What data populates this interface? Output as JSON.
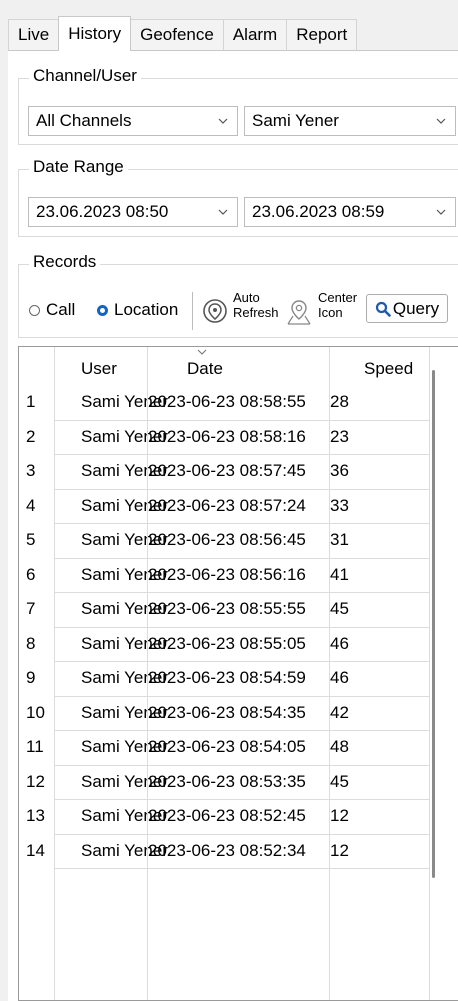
{
  "tabs": [
    "Live",
    "History",
    "Geofence",
    "Alarm",
    "Report"
  ],
  "active_tab": "History",
  "channel_user": {
    "title": "Channel/User",
    "channel": "All Channels",
    "user": "Sami Yener"
  },
  "date_range": {
    "title": "Date Range",
    "start": "23.06.2023 08:50",
    "end": "23.06.2023 08:59"
  },
  "records": {
    "title": "Records",
    "call_label": "Call",
    "location_label": "Location",
    "selected": "Location",
    "auto_refresh": [
      "Auto",
      "Refresh"
    ],
    "center_icon": [
      "Center",
      "Icon"
    ],
    "query_label": "Query"
  },
  "table": {
    "columns": [
      "User",
      "Date",
      "Speed"
    ],
    "sorted_column": "Date",
    "rows": [
      {
        "n": "1",
        "user": "Sami Yener",
        "date": "2023-06-23 08:58:55",
        "speed": "28"
      },
      {
        "n": "2",
        "user": "Sami Yener",
        "date": "2023-06-23 08:58:16",
        "speed": "23"
      },
      {
        "n": "3",
        "user": "Sami Yener",
        "date": "2023-06-23 08:57:45",
        "speed": "36"
      },
      {
        "n": "4",
        "user": "Sami Yener",
        "date": "2023-06-23 08:57:24",
        "speed": "33"
      },
      {
        "n": "5",
        "user": "Sami Yener",
        "date": "2023-06-23 08:56:45",
        "speed": "31"
      },
      {
        "n": "6",
        "user": "Sami Yener",
        "date": "2023-06-23 08:56:16",
        "speed": "41"
      },
      {
        "n": "7",
        "user": "Sami Yener",
        "date": "2023-06-23 08:55:55",
        "speed": "45"
      },
      {
        "n": "8",
        "user": "Sami Yener",
        "date": "2023-06-23 08:55:05",
        "speed": "46"
      },
      {
        "n": "9",
        "user": "Sami Yener",
        "date": "2023-06-23 08:54:59",
        "speed": "46"
      },
      {
        "n": "10",
        "user": "Sami Yener",
        "date": "2023-06-23 08:54:35",
        "speed": "42"
      },
      {
        "n": "11",
        "user": "Sami Yener",
        "date": "2023-06-23 08:54:05",
        "speed": "48"
      },
      {
        "n": "12",
        "user": "Sami Yener",
        "date": "2023-06-23 08:53:35",
        "speed": "45"
      },
      {
        "n": "13",
        "user": "Sami Yener",
        "date": "2023-06-23 08:52:45",
        "speed": "12"
      },
      {
        "n": "14",
        "user": "Sami Yener",
        "date": "2023-06-23 08:52:34",
        "speed": "12"
      }
    ]
  },
  "colors": {
    "accent": "#1565c0",
    "border": "#dadada",
    "background": "#f0f0f0"
  },
  "icons": {
    "auto_refresh": "location-refresh-icon",
    "center": "map-pin-icon",
    "query": "search-icon",
    "dropdown": "chevron-down-icon",
    "sort": "sort-indicator-icon"
  }
}
